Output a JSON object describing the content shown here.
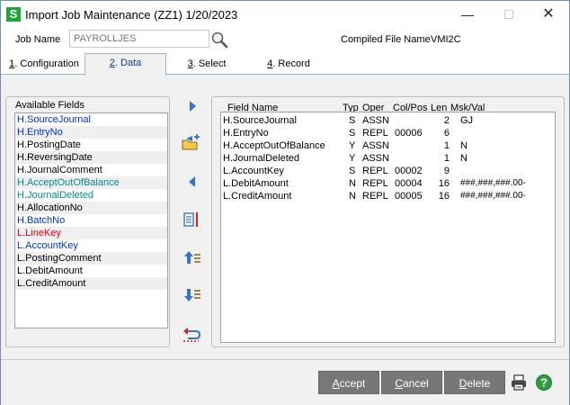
{
  "window": {
    "title": "Import Job Maintenance (ZZ1) 1/20/2023",
    "icon_letter": "S",
    "controls": {
      "minimize": "—",
      "maximize": "☐",
      "close": "✕"
    }
  },
  "header": {
    "job_name_label": "Job Name",
    "job_name_value": "PAYROLLJES",
    "compiled_file_label": "Compiled File Name",
    "compiled_file_value": "VMI2C"
  },
  "tabs": [
    {
      "num": "1",
      "label": ". Configuration"
    },
    {
      "num": "2",
      "label": ". Data"
    },
    {
      "num": "3",
      "label": ". Select"
    },
    {
      "num": "4",
      "label": ". Record"
    }
  ],
  "available_fields": {
    "title": "Available Fields",
    "items": [
      {
        "label": "H.SourceJournal",
        "color": "#0033cc"
      },
      {
        "label": "H.EntryNo",
        "color": "#0033cc"
      },
      {
        "label": "H.PostingDate",
        "color": "#000000"
      },
      {
        "label": "H.ReversingDate",
        "color": "#000000"
      },
      {
        "label": "H.JournalComment",
        "color": "#000000"
      },
      {
        "label": "H.AcceptOutOfBalance",
        "color": "#008b8b"
      },
      {
        "label": "H.JournalDeleted",
        "color": "#008b8b"
      },
      {
        "label": "H.AllocationNo",
        "color": "#000000"
      },
      {
        "label": "H.BatchNo",
        "color": "#0033cc"
      },
      {
        "label": "L.LineKey",
        "color": "#e0001a"
      },
      {
        "label": "L.AccountKey",
        "color": "#0033cc"
      },
      {
        "label": "L.PostingComment",
        "color": "#000000"
      },
      {
        "label": "L.DebitAmount",
        "color": "#000000"
      },
      {
        "label": "L.CreditAmount",
        "color": "#000000"
      }
    ]
  },
  "grid": {
    "headers": {
      "field_name": "Field Name",
      "typ": "Typ",
      "oper": "Oper",
      "col_pos": "Col/Pos",
      "len": "Len",
      "msk_val": "Msk/Val"
    },
    "rows": [
      {
        "field_name": "H.SourceJournal",
        "typ": "S",
        "oper": "ASSN",
        "col_pos": "",
        "len": "2",
        "msk_val": "GJ"
      },
      {
        "field_name": "H.EntryNo",
        "typ": "S",
        "oper": "REPL",
        "col_pos": "00006",
        "len": "6",
        "msk_val": ""
      },
      {
        "field_name": "H.AcceptOutOfBalance",
        "typ": "Y",
        "oper": "ASSN",
        "col_pos": "",
        "len": "1",
        "msk_val": "N"
      },
      {
        "field_name": "H.JournalDeleted",
        "typ": "Y",
        "oper": "ASSN",
        "col_pos": "",
        "len": "1",
        "msk_val": "N"
      },
      {
        "field_name": "L.AccountKey",
        "typ": "S",
        "oper": "REPL",
        "col_pos": "00002",
        "len": "9",
        "msk_val": ""
      },
      {
        "field_name": "L.DebitAmount",
        "typ": "N",
        "oper": "REPL",
        "col_pos": "00004",
        "len": "16",
        "msk_val": "###,###,###.00-"
      },
      {
        "field_name": "L.CreditAmount",
        "typ": "N",
        "oper": "REPL",
        "col_pos": "00005",
        "len": "16",
        "msk_val": "###,###,###.00-"
      }
    ]
  },
  "buttons": {
    "accept": {
      "key": "A",
      "rest": "ccept"
    },
    "cancel": {
      "key": "C",
      "rest": "ancel"
    },
    "delete": {
      "key": "D",
      "rest": "elete"
    }
  },
  "colors": {
    "accent_blue": "#0a3f8a",
    "button_gray": "#777777",
    "help_green": "#2e9e3e"
  }
}
